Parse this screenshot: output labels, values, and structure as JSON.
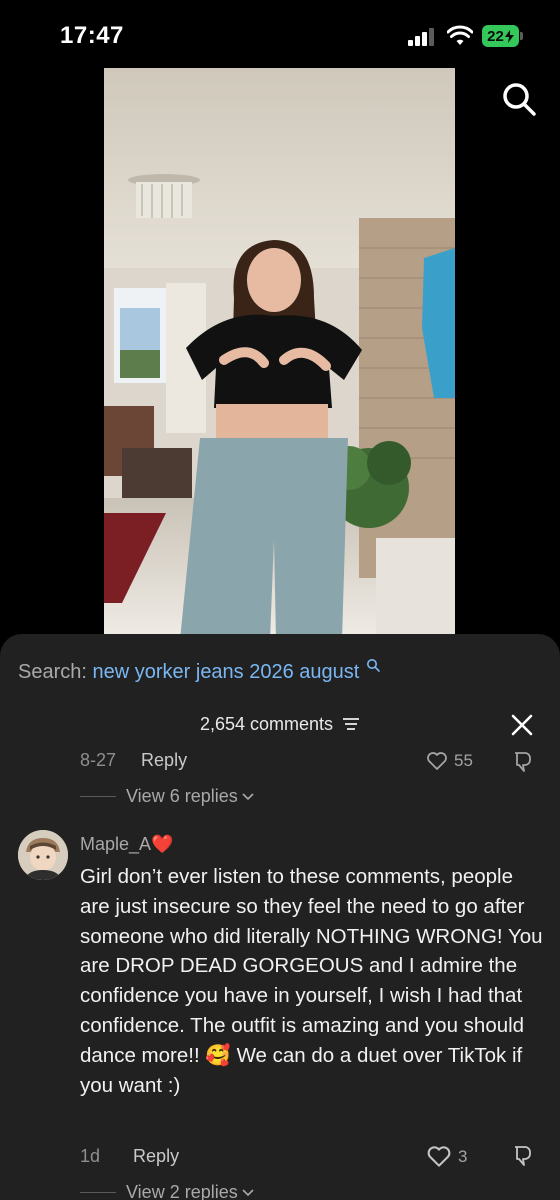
{
  "status_bar": {
    "time": "17:47",
    "battery": "22"
  },
  "search": {
    "label": "Search:",
    "query": "new yorker jeans 2026 august"
  },
  "comments_header": {
    "count": "2,654 comments"
  },
  "previous_comment": {
    "date": "8-27",
    "reply_label": "Reply",
    "likes": "55",
    "view_replies": "View 6 replies"
  },
  "comment": {
    "username": "Maple_A",
    "username_emoji": "❤️",
    "text": "Girl don’t ever listen to these comments, people are just insecure so they feel the need to go after someone who did literally NOTHING WRONG! You are DROP DEAD GORGEOUS and I admire the confidence you have in yourself, I wish I had that confidence. The outfit is amazing and you should dance more!! 🥰 We can do a duet over TikTok if you want :)",
    "date": "1d",
    "reply_label": "Reply",
    "likes": "3",
    "view_replies": "View 2 replies"
  },
  "colors": {
    "sheet_background": "#212121",
    "search_query": "#7ab7f2",
    "battery": "#34c759",
    "heart_emoji": "#e0245e"
  },
  "icons": [
    "search-icon",
    "close-icon",
    "filter-icon",
    "heart-outline-icon",
    "dislike-icon",
    "chevron-down-icon",
    "wifi-icon",
    "cellular-signal-icon",
    "battery-icon"
  ]
}
